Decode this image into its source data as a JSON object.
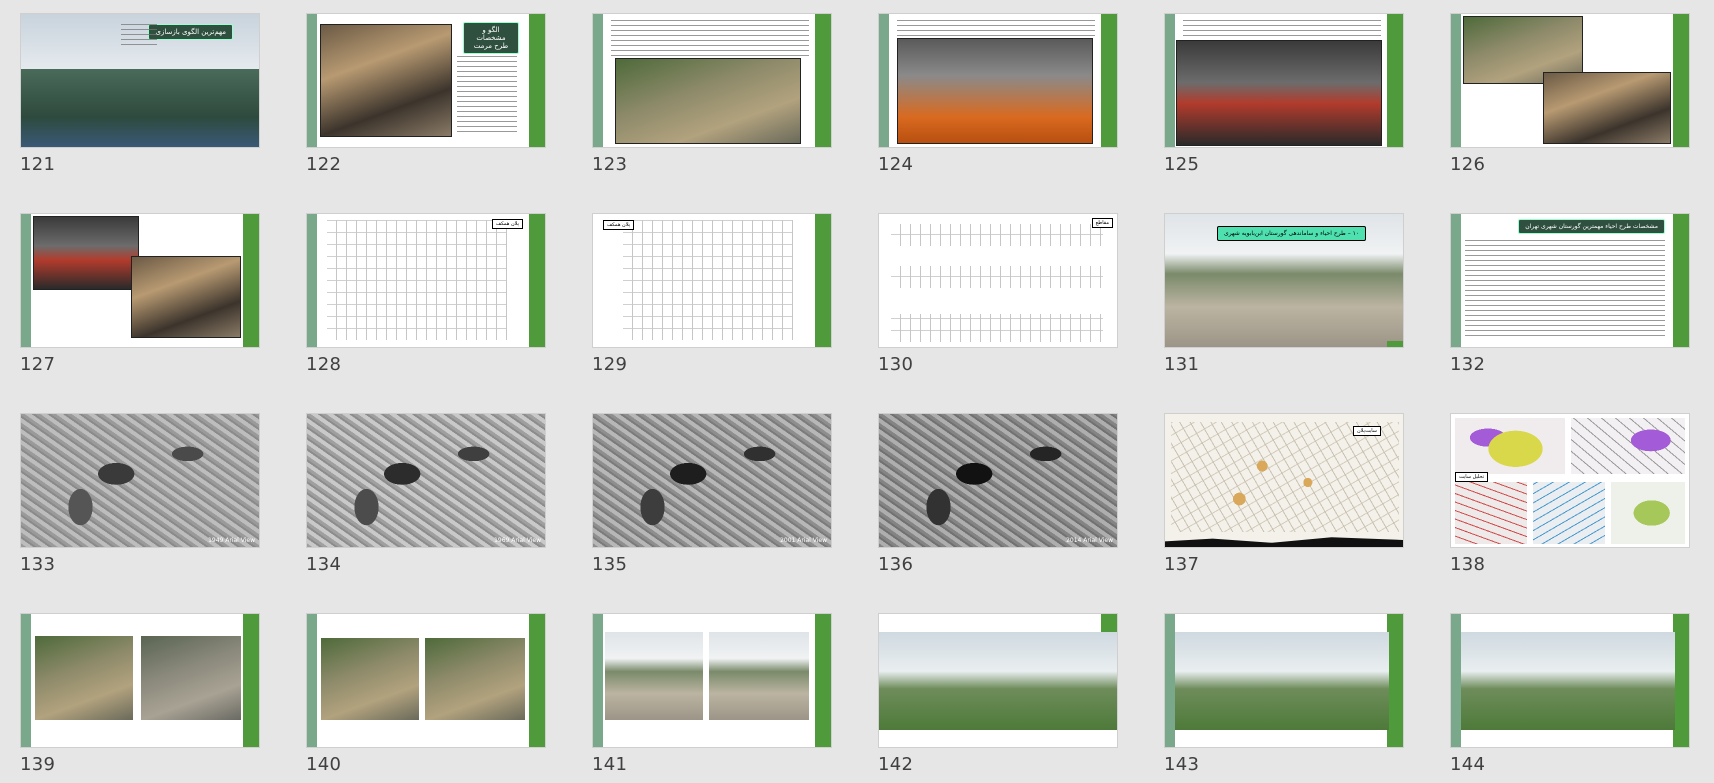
{
  "slides": [
    {
      "number": "121",
      "title": "مهم‌ترین الگوی بازسازی"
    },
    {
      "number": "122",
      "title": "الگو و مشخصات طرح مرمت"
    },
    {
      "number": "123",
      "title": ""
    },
    {
      "number": "124",
      "title": ""
    },
    {
      "number": "125",
      "title": ""
    },
    {
      "number": "126",
      "title": ""
    },
    {
      "number": "127",
      "title": ""
    },
    {
      "number": "128",
      "label": "پلان همکف"
    },
    {
      "number": "129",
      "label": "پلان همکف"
    },
    {
      "number": "130",
      "label": "مقاطع"
    },
    {
      "number": "131",
      "title": "۱۰ – طرح احیاء و ساماندهی گورستان ابن‌بابویه شهری"
    },
    {
      "number": "132",
      "title": "مشخصات طرح احیاء مهمترین گورستان شهری تهران"
    },
    {
      "number": "133",
      "caption": "1949 Arial View"
    },
    {
      "number": "134",
      "caption": "1969 Arial View"
    },
    {
      "number": "135",
      "caption": "2001 Arial View"
    },
    {
      "number": "136",
      "caption": "2014 Arial View"
    },
    {
      "number": "137",
      "label": "سایت‌پلان"
    },
    {
      "number": "138",
      "label": "تحلیل سایت"
    },
    {
      "number": "139",
      "title": ""
    },
    {
      "number": "140",
      "title": ""
    },
    {
      "number": "141",
      "title": ""
    },
    {
      "number": "142",
      "title": ""
    },
    {
      "number": "143",
      "title": ""
    },
    {
      "number": "144",
      "title": ""
    }
  ]
}
